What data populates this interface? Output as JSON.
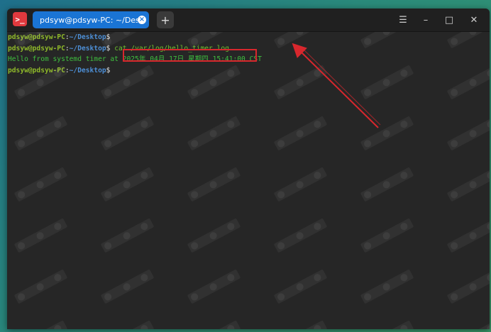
{
  "window": {
    "app_icon_glyph": ">_",
    "tab_title": "pdsyw@pdsyw-PC: ~/Desktop",
    "tab_close_glyph": "×",
    "new_tab_glyph": "+",
    "controls": {
      "menu": "☰",
      "minimize": "–",
      "maximize": "□",
      "close": "✕"
    }
  },
  "terminal": {
    "lines": [
      {
        "user": "pdsyw@pdsyw-PC",
        "sep": ":",
        "path": "~/Desktop",
        "dollar": "$",
        "command": ""
      },
      {
        "user": "pdsyw@pdsyw-PC",
        "sep": ":",
        "path": "~/Desktop",
        "dollar": "$",
        "command": " cat /var/log/hello_timer.log"
      },
      {
        "output": "Hello from systemd timer at 2025年 04月 17日 星期四 15:41:00 CST"
      },
      {
        "user": "pdsyw@pdsyw-PC",
        "sep": ":",
        "path": "~/Desktop",
        "dollar": "$",
        "command": ""
      }
    ]
  },
  "annotation": {
    "color": "#d8272d"
  },
  "colors": {
    "user": "#8fb92a",
    "path": "#4d8fd6",
    "output": "#3fbf3f",
    "tab": "#1a74d4"
  }
}
